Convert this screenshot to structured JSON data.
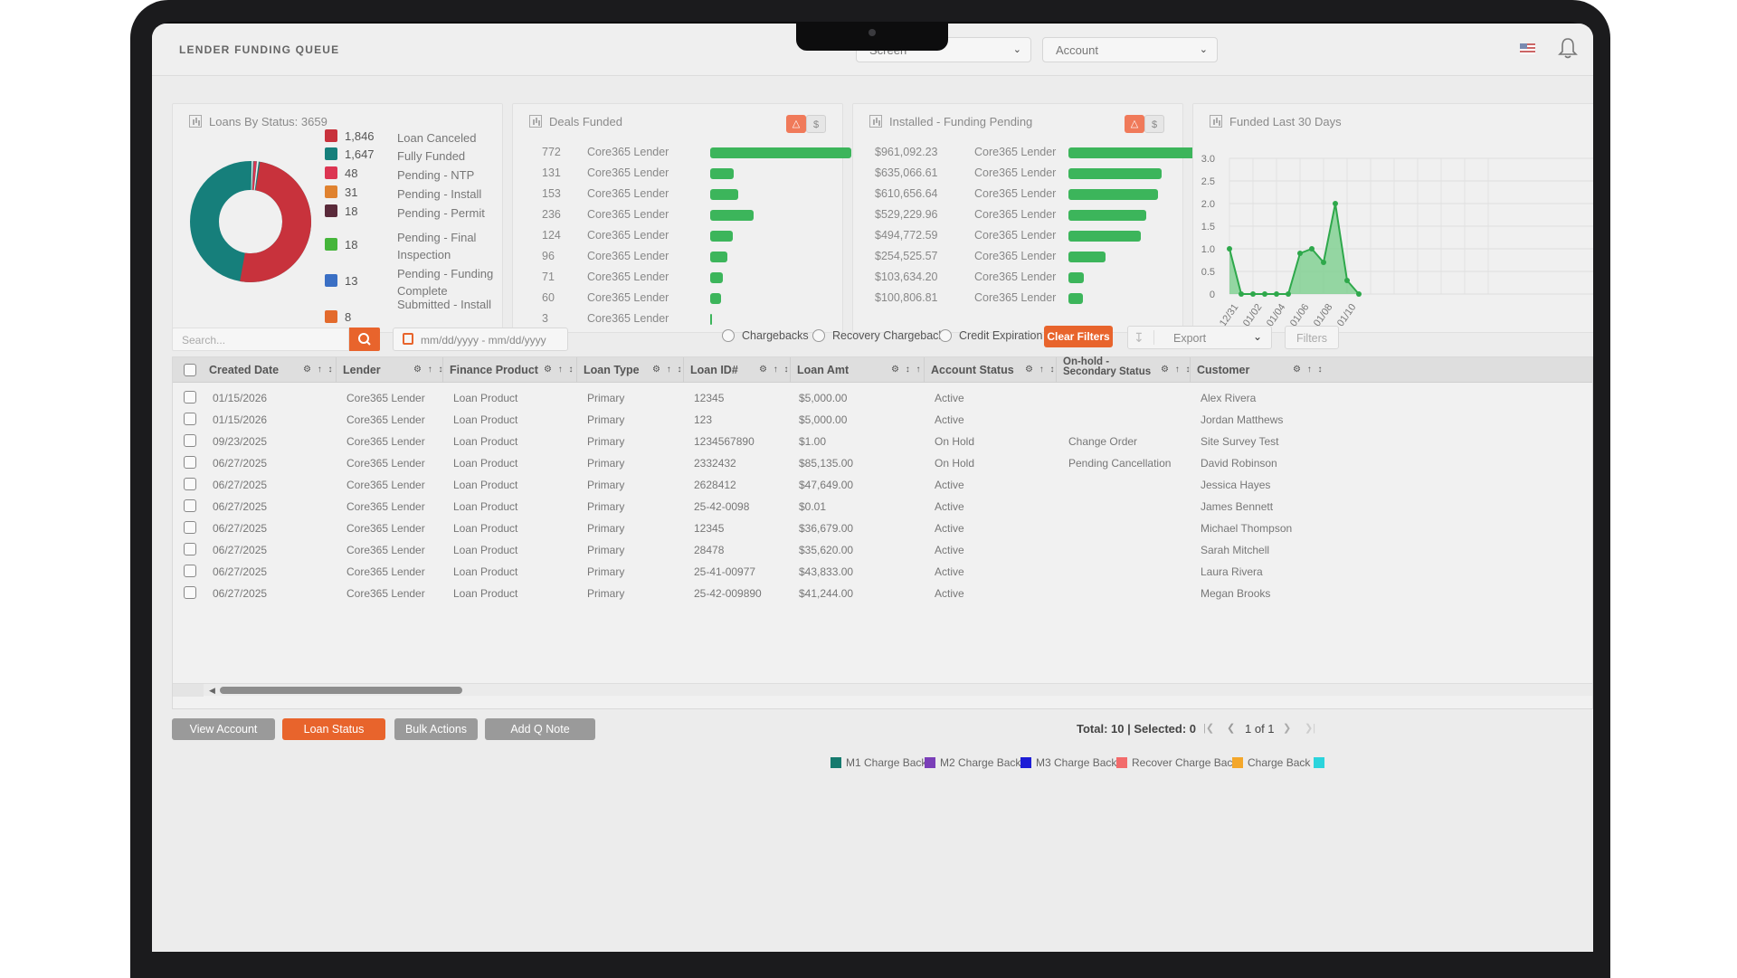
{
  "header": {
    "title": "LENDER FUNDING QUEUE",
    "screen_select": "Screen",
    "account_select": "Account"
  },
  "loans_by_status": {
    "title": "Loans By Status: 3659",
    "items": [
      {
        "value": "1,846",
        "label": "Loan Canceled",
        "color": "#c8323c"
      },
      {
        "value": "1,647",
        "label": "Fully Funded",
        "color": "#167f7b"
      },
      {
        "value": "48",
        "label": "Pending - NTP",
        "color": "#dc3552"
      },
      {
        "value": "31",
        "label": "Pending - Install",
        "color": "#e0822f"
      },
      {
        "value": "18",
        "label": "Pending - Permit",
        "color": "#5a2a3a"
      },
      {
        "value": "18",
        "label": "Pending - Final Inspection",
        "color": "#45b53a"
      },
      {
        "value": "13",
        "label": "Pending - Funding Complete",
        "color": "#3a6fc4"
      },
      {
        "value": "8",
        "label": "Submitted - Install Package",
        "color": "#e36a2c"
      }
    ]
  },
  "deals_funded": {
    "title": "Deals Funded",
    "toggle_alt": "$",
    "rows": [
      {
        "count": "772",
        "lender": "Core365 Lender",
        "value": 772
      },
      {
        "count": "131",
        "lender": "Core365 Lender",
        "value": 131
      },
      {
        "count": "153",
        "lender": "Core365 Lender",
        "value": 153
      },
      {
        "count": "236",
        "lender": "Core365 Lender",
        "value": 236
      },
      {
        "count": "124",
        "lender": "Core365 Lender",
        "value": 124
      },
      {
        "count": "96",
        "lender": "Core365 Lender",
        "value": 96
      },
      {
        "count": "71",
        "lender": "Core365 Lender",
        "value": 71
      },
      {
        "count": "60",
        "lender": "Core365 Lender",
        "value": 60
      },
      {
        "count": "3",
        "lender": "Core365 Lender",
        "value": 3
      }
    ]
  },
  "installed_pending": {
    "title": "Installed - Funding Pending",
    "toggle_alt": "$",
    "rows": [
      {
        "amount": "$961,092.23",
        "lender": "Core365 Lender",
        "value": 961092.23
      },
      {
        "amount": "$635,066.61",
        "lender": "Core365 Lender",
        "value": 635066.61
      },
      {
        "amount": "$610,656.64",
        "lender": "Core365 Lender",
        "value": 610656.64
      },
      {
        "amount": "$529,229.96",
        "lender": "Core365 Lender",
        "value": 529229.96
      },
      {
        "amount": "$494,772.59",
        "lender": "Core365 Lender",
        "value": 494772.59
      },
      {
        "amount": "$254,525.57",
        "lender": "Core365 Lender",
        "value": 254525.57
      },
      {
        "amount": "$103,634.20",
        "lender": "Core365 Lender",
        "value": 103634.2
      },
      {
        "amount": "$100,806.81",
        "lender": "Core365 Lender",
        "value": 100806.81
      }
    ]
  },
  "chart_data": {
    "type": "area",
    "title": "Funded Last 30 Days",
    "y_ticks": [
      "3.0",
      "2.5",
      "2.0",
      "1.5",
      "1.0",
      "0.5",
      "0"
    ],
    "x_ticks": [
      "12/31",
      "01/02",
      "01/04",
      "01/06",
      "01/08",
      "01/10"
    ],
    "ylim": [
      0,
      3
    ],
    "values": [
      1.0,
      0,
      0,
      0,
      0,
      0,
      0.9,
      1.0,
      0.7,
      2.0,
      0.3,
      0
    ]
  },
  "filters": {
    "search_placeholder": "Search...",
    "date_placeholder": "mm/dd/yyyy - mm/dd/yyyy",
    "radio_chargebacks": "Chargebacks",
    "radio_recovery": "Recovery Chargeback",
    "radio_credit": "Credit Expiration",
    "clear_filters": "Clear Filters",
    "export": "Export",
    "filters": "Filters"
  },
  "table": {
    "columns": [
      "Created Date",
      "Lender",
      "Finance Product",
      "Loan Type",
      "Loan ID#",
      "Loan Amt",
      "Account Status",
      "On-hold - Secondary Status",
      "Customer"
    ],
    "rows": [
      [
        "01/15/2026",
        "Core365 Lender",
        "Loan Product",
        "Primary",
        "12345",
        "$5,000.00",
        "Active",
        "",
        "Alex Rivera"
      ],
      [
        "01/15/2026",
        "Core365 Lender",
        "Loan Product",
        "Primary",
        "123",
        "$5,000.00",
        "Active",
        "",
        "Jordan Matthews"
      ],
      [
        "09/23/2025",
        "Core365 Lender",
        "Loan Product",
        "Primary",
        "1234567890",
        "$1.00",
        "On Hold",
        "Change Order",
        "Site Survey Test"
      ],
      [
        "06/27/2025",
        "Core365 Lender",
        "Loan Product",
        "Primary",
        "2332432",
        "$85,135.00",
        "On Hold",
        "Pending Cancellation",
        "David Robinson"
      ],
      [
        "06/27/2025",
        "Core365 Lender",
        "Loan Product",
        "Primary",
        "2628412",
        "$47,649.00",
        "Active",
        "",
        "Jessica Hayes"
      ],
      [
        "06/27/2025",
        "Core365 Lender",
        "Loan Product",
        "Primary",
        "25-42-0098",
        "$0.01",
        "Active",
        "",
        "James Bennett"
      ],
      [
        "06/27/2025",
        "Core365 Lender",
        "Loan Product",
        "Primary",
        "12345",
        "$36,679.00",
        "Active",
        "",
        "Michael Thompson"
      ],
      [
        "06/27/2025",
        "Core365 Lender",
        "Loan Product",
        "Primary",
        "28478",
        "$35,620.00",
        "Active",
        "",
        "Sarah Mitchell"
      ],
      [
        "06/27/2025",
        "Core365 Lender",
        "Loan Product",
        "Primary",
        "25-41-00977",
        "$43,833.00",
        "Active",
        "",
        "Laura Rivera"
      ],
      [
        "06/27/2025",
        "Core365 Lender",
        "Loan Product",
        "Primary",
        "25-42-009890",
        "$41,244.00",
        "Active",
        "",
        "Megan Brooks"
      ]
    ]
  },
  "actions": {
    "view_account": "View Account",
    "loan_status": "Loan Status",
    "bulk_actions": "Bulk Actions",
    "add_q_note": "Add Q Note"
  },
  "pagination": {
    "summary": "Total: 10 | Selected: 0",
    "page": "1 of 1"
  },
  "legend_bottom": [
    {
      "label": "M1 Charge Back",
      "color": "#157a6e"
    },
    {
      "label": "M2 Charge Back",
      "color": "#7a3fb8"
    },
    {
      "label": "M3 Charge Back",
      "color": "#1d1dd6"
    },
    {
      "label": "Recover Charge Back",
      "color": "#f26b6b"
    },
    {
      "label": "Charge Back",
      "color": "#f4a72a"
    }
  ],
  "colors": {
    "accent": "#e8642c",
    "bar_green": "#3cb55b",
    "button_gray": "#9a9a9a"
  }
}
